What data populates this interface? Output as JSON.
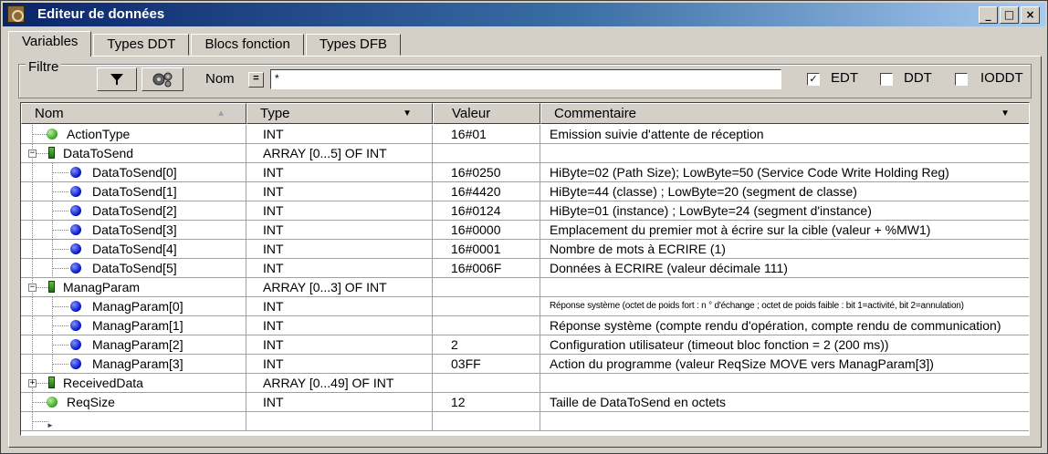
{
  "window": {
    "title": "Editeur de données",
    "buttons": {
      "minimize": "_",
      "maximize": "□",
      "close": "×"
    }
  },
  "tabs": [
    {
      "label": "Variables",
      "active": true
    },
    {
      "label": "Types DDT",
      "active": false
    },
    {
      "label": "Blocs fonction",
      "active": false
    },
    {
      "label": "Types DFB",
      "active": false
    }
  ],
  "filter": {
    "group_label": "Filtre",
    "filter_icon": "funnel-icon",
    "config_icon": "gears-icon",
    "nom_label": "Nom",
    "eq_label": "=",
    "nom_value": "*",
    "checks": [
      {
        "label": "EDT",
        "checked": true
      },
      {
        "label": "DDT",
        "checked": false
      },
      {
        "label": "IODDT",
        "checked": false
      }
    ]
  },
  "columns": [
    "Nom",
    "Type",
    "Valeur",
    "Commentaire"
  ],
  "rows": [
    {
      "name": "ActionType",
      "type": "INT",
      "value": "16#01",
      "comment": "Emission suivie d'attente de réception",
      "icon": "green",
      "indent": 0
    },
    {
      "name": "DataToSend",
      "type": "ARRAY [0...5] OF INT",
      "value": "",
      "comment": "",
      "icon": "array",
      "indent": 0,
      "expander": "-"
    },
    {
      "name": "DataToSend[0]",
      "type": "INT",
      "value": "16#0250",
      "comment": "HiByte=02 (Path Size); LowByte=50 (Service Code Write Holding Reg)",
      "icon": "blue",
      "indent": 1
    },
    {
      "name": "DataToSend[1]",
      "type": "INT",
      "value": "16#4420",
      "comment": "HiByte=44 (classe) ; LowByte=20 (segment de classe)",
      "icon": "blue",
      "indent": 1
    },
    {
      "name": "DataToSend[2]",
      "type": "INT",
      "value": "16#0124",
      "comment": "HiByte=01 (instance) ; LowByte=24 (segment d'instance)",
      "icon": "blue",
      "indent": 1
    },
    {
      "name": "DataToSend[3]",
      "type": "INT",
      "value": "16#0000",
      "comment": "Emplacement du premier mot à écrire sur la cible (valeur + %MW1)",
      "icon": "blue",
      "indent": 1
    },
    {
      "name": "DataToSend[4]",
      "type": "INT",
      "value": "16#0001",
      "comment": "Nombre de mots à ECRIRE (1)",
      "icon": "blue",
      "indent": 1
    },
    {
      "name": "DataToSend[5]",
      "type": "INT",
      "value": "16#006F",
      "comment": "Données à ECRIRE (valeur décimale 111)",
      "icon": "blue",
      "indent": 1
    },
    {
      "name": "ManagParam",
      "type": "ARRAY [0...3] OF INT",
      "value": "",
      "comment": "",
      "icon": "array",
      "indent": 0,
      "expander": "-"
    },
    {
      "name": "ManagParam[0]",
      "type": "INT",
      "value": "",
      "comment": "Réponse système (octet de poids fort : n ° d'échange ; octet de poids faible : bit 1=activité, bit 2=annulation)",
      "icon": "blue",
      "indent": 1,
      "small": true
    },
    {
      "name": "ManagParam[1]",
      "type": "INT",
      "value": "",
      "comment": "Réponse système (compte rendu d'opération, compte rendu de communication)",
      "icon": "blue",
      "indent": 1
    },
    {
      "name": "ManagParam[2]",
      "type": "INT",
      "value": "2",
      "comment": "Configuration utilisateur (timeout bloc fonction = 2 (200 ms))",
      "icon": "blue",
      "indent": 1
    },
    {
      "name": "ManagParam[3]",
      "type": "INT",
      "value": "03FF",
      "comment": "Action du programme (valeur ReqSize MOVE vers ManagParam[3])",
      "icon": "blue",
      "indent": 1
    },
    {
      "name": "ReceivedData",
      "type": "ARRAY [0...49] OF INT",
      "value": "",
      "comment": "",
      "icon": "array",
      "indent": 0,
      "expander": "+"
    },
    {
      "name": "ReqSize",
      "type": "INT",
      "value": "12",
      "comment": "Taille de DataToSend en octets",
      "icon": "green",
      "indent": 0
    },
    {
      "name": "",
      "type": "",
      "value": "",
      "comment": "",
      "icon": "arrow",
      "indent": 0
    }
  ]
}
